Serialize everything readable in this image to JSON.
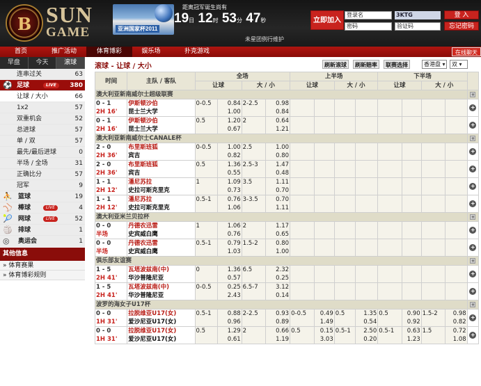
{
  "header": {
    "brand_top": "SUN",
    "brand_bottom": "GAME",
    "emblem": "B",
    "banner_text": "亚洲国家杯2011",
    "countdown_title": "距离冠军诞生尚有",
    "countdown": {
      "days": "19",
      "d_unit": "日",
      "hours": "12",
      "h_unit": "时",
      "minutes": "53",
      "m_unit": "分",
      "seconds": "47",
      "s_unit": "秒"
    },
    "maintenance": "未星团例行维护",
    "join_label": "立即加入",
    "username_value": "登录名",
    "password_value": "密码",
    "verify_value": "验证码",
    "verify_code": "3KTG",
    "login_label": "登 入",
    "forgot_label": "忘记密码"
  },
  "nav": {
    "items": [
      "首页",
      "推广活动",
      "体育博彩",
      "娱乐场",
      "扑克游戏"
    ],
    "online": "在线聊天"
  },
  "sidebar": {
    "tabs": [
      "早盘",
      "今天",
      "滚球"
    ],
    "rows": [
      {
        "label": "连串过关",
        "count": "63",
        "kind": "plain"
      },
      {
        "label": "足球",
        "count": "380",
        "kind": "active",
        "live": "LIVE",
        "icon": "soccer-icon"
      },
      {
        "label": "让球 / 大小",
        "count": "66",
        "kind": "sel"
      },
      {
        "label": "1x2",
        "count": "57",
        "kind": "plain"
      },
      {
        "label": "双重机会",
        "count": "52",
        "kind": "plain"
      },
      {
        "label": "总进球",
        "count": "57",
        "kind": "plain"
      },
      {
        "label": "单 / 双",
        "count": "57",
        "kind": "plain"
      },
      {
        "label": "最先/最后进球",
        "count": "0",
        "kind": "plain"
      },
      {
        "label": "半场 / 全场",
        "count": "31",
        "kind": "plain"
      },
      {
        "label": "正确比分",
        "count": "57",
        "kind": "plain"
      },
      {
        "label": "冠军",
        "count": "9",
        "kind": "plain"
      },
      {
        "label": "篮球",
        "count": "19",
        "kind": "sport",
        "icon": "basketball-icon"
      },
      {
        "label": "棒球",
        "count": "4",
        "kind": "sport",
        "live": "LIVE",
        "icon": "baseball-icon"
      },
      {
        "label": "网球",
        "count": "52",
        "kind": "sport",
        "live": "LIVE",
        "icon": "tennis-icon"
      },
      {
        "label": "排球",
        "count": "1",
        "kind": "sport",
        "icon": "volleyball-icon"
      },
      {
        "label": "奥运会",
        "count": "1",
        "kind": "sport",
        "icon": "olympic-rings-icon"
      }
    ],
    "info_title": "其他信息",
    "info_links": [
      "» 体育赛果",
      "» 体育博彩规则"
    ]
  },
  "main": {
    "title": "滚球 - 让球 / 大小",
    "refresh": "刷新滚球",
    "refresh_early": "刷新赔率",
    "league_select": "联赛选择",
    "odds_type": "香港盘",
    "sort": "双",
    "headers": {
      "time": "时间",
      "teams": "主队 / 客队",
      "full": "全场",
      "first": "上半场",
      "second": "下半场",
      "hdp": "让球",
      "ou": "大 / 小"
    },
    "leagues": [
      {
        "name": "澳大利亚新南威尔士超级联赛",
        "events": [
          {
            "score": "0 - 1",
            "time": "2H 16'",
            "home": "伊斯顿沙伯",
            "away": "昆士兰大学",
            "hdp": "0-0.5",
            "h1": "0.84",
            "h2": "1.00",
            "ou": "2-2.5",
            "o1": "0.98",
            "o2": "0.84",
            "fh": "",
            "f1": "",
            "f2": "",
            "fo": "",
            "fo1": "",
            "fo2": "",
            "sh": "",
            "s1": "",
            "s2": "",
            "so": "",
            "so1": "",
            "so2": ""
          },
          {
            "score": "0 - 1",
            "time": "2H 16'",
            "home": "伊斯顿沙伯",
            "away": "昆士兰大学",
            "hdp": "0.5",
            "h1": "1.20",
            "h2": "0.67",
            "ou": "2",
            "o1": "0.64",
            "o2": "1.21",
            "fh": "",
            "f1": "",
            "f2": "",
            "fo": "",
            "fo1": "",
            "fo2": "",
            "sh": "",
            "s1": "",
            "s2": "",
            "so": "",
            "so1": "",
            "so2": ""
          }
        ]
      },
      {
        "name": "澳大利亚新南威尔士CANALE杯",
        "events": [
          {
            "score": "2 - 0",
            "time": "2H 36'",
            "home": "布里斯班狐",
            "away": "宾吉",
            "hdp": "0-0.5",
            "h1": "1.00",
            "h2": "0.82",
            "ou": "2.5",
            "o1": "1.00",
            "o2": "0.80",
            "fh": "",
            "f1": "",
            "f2": "",
            "fo": "",
            "fo1": "",
            "fo2": "",
            "sh": "",
            "s1": "",
            "s2": "",
            "so": "",
            "so1": "",
            "so2": ""
          },
          {
            "score": "2 - 0",
            "time": "2H 36'",
            "home": "布里斯班狐",
            "away": "宾吉",
            "hdp": "0.5",
            "h1": "1.36",
            "h2": "0.55",
            "ou": "2.5-3",
            "o1": "1.47",
            "o2": "0.48",
            "fh": "",
            "f1": "",
            "f2": "",
            "fo": "",
            "fo1": "",
            "fo2": "",
            "sh": "",
            "s1": "",
            "s2": "",
            "so": "",
            "so1": "",
            "so2": ""
          },
          {
            "score": "1 - 1",
            "time": "2H 12'",
            "home": "潘尼苏拉",
            "away": "史拉可斯克里克",
            "hdp": "1",
            "h1": "1.09",
            "h2": "0.73",
            "ou": "3.5",
            "o1": "1.11",
            "o2": "0.70",
            "fh": "",
            "f1": "",
            "f2": "",
            "fo": "",
            "fo1": "",
            "fo2": "",
            "sh": "",
            "s1": "",
            "s2": "",
            "so": "",
            "so1": "",
            "so2": ""
          },
          {
            "score": "1 - 1",
            "time": "2H 12'",
            "home": "潘尼苏拉",
            "away": "史拉可斯克里克",
            "hdp": "0.5-1",
            "h1": "0.76",
            "h2": "1.06",
            "ou": "3-3.5",
            "o1": "0.70",
            "o2": "1.11",
            "fh": "",
            "f1": "",
            "f2": "",
            "fo": "",
            "fo1": "",
            "fo2": "",
            "sh": "",
            "s1": "",
            "s2": "",
            "so": "",
            "so1": "",
            "so2": ""
          }
        ]
      },
      {
        "name": "澳大利亚米兰贝拉杯",
        "events": [
          {
            "score": "0 - 0",
            "time": "半场",
            "home": "丹德农迅雷",
            "away": "史宾威白鹰",
            "hdp": "1",
            "h1": "1.06",
            "h2": "0.76",
            "ou": "2",
            "o1": "1.17",
            "o2": "0.65",
            "fh": "",
            "f1": "",
            "f2": "",
            "fo": "",
            "fo1": "",
            "fo2": "",
            "sh": "",
            "s1": "",
            "s2": "",
            "so": "",
            "so1": "",
            "so2": ""
          },
          {
            "score": "0 - 0",
            "time": "半场",
            "home": "丹德农迅雷",
            "away": "史宾威白鹰",
            "hdp": "0.5-1",
            "h1": "0.79",
            "h2": "1.03",
            "ou": "1.5-2",
            "o1": "0.80",
            "o2": "1.00",
            "fh": "",
            "f1": "",
            "f2": "",
            "fo": "",
            "fo1": "",
            "fo2": "",
            "sh": "",
            "s1": "",
            "s2": "",
            "so": "",
            "so1": "",
            "so2": ""
          }
        ]
      },
      {
        "name": "俱乐部友谊赛",
        "events": [
          {
            "score": "1 - 5",
            "time": "2H 41'",
            "home": "瓦塔波兹南(中)",
            "away": "华沙普隆尼亚",
            "hdp": "0",
            "h1": "1.36",
            "h2": "0.57",
            "ou": "6.5",
            "o1": "2.32",
            "o2": "0.25",
            "fh": "",
            "f1": "",
            "f2": "",
            "fo": "",
            "fo1": "",
            "fo2": "",
            "sh": "",
            "s1": "",
            "s2": "",
            "so": "",
            "so1": "",
            "so2": ""
          },
          {
            "score": "1 - 5",
            "time": "2H 41'",
            "home": "瓦塔波兹南(中)",
            "away": "华沙普隆尼亚",
            "hdp": "0-0.5",
            "h1": "0.25",
            "h2": "2.43",
            "ou": "6.5-7",
            "o1": "3.12",
            "o2": "0.14",
            "fh": "",
            "f1": "",
            "f2": "",
            "fo": "",
            "fo1": "",
            "fo2": "",
            "sh": "",
            "s1": "",
            "s2": "",
            "so": "",
            "so1": "",
            "so2": ""
          }
        ]
      },
      {
        "name": "波罗的海女子U17杯",
        "events": [
          {
            "score": "0 - 0",
            "time": "1H 31'",
            "home": "拉脱维亚U17(女)",
            "away": "爱沙尼亚U17(女)",
            "hdp": "0.5-1",
            "h1": "0.88",
            "h2": "0.96",
            "ou": "2-2.5",
            "o1": "0.93",
            "o2": "0.89",
            "fh": "0-0.5",
            "f1": "0.49",
            "f2": "1.49",
            "fo": "0.5",
            "fo1": "1.35",
            "fo2": "0.54",
            "sh": "0.5",
            "s1": "0.90",
            "s2": "0.92",
            "so": "1.5-2",
            "so1": "0.98",
            "so2": "0.82"
          },
          {
            "score": "0 - 0",
            "time": "1H 31'",
            "home": "拉脱维亚U17(女)",
            "away": "爱沙尼亚U17(女)",
            "hdp": "0.5",
            "h1": "1.29",
            "h2": "0.61",
            "ou": "2",
            "o1": "0.66",
            "o2": "1.19",
            "fh": "0.5",
            "f1": "0.15",
            "f2": "3.03",
            "fo": "0.5-1",
            "fo1": "2.50",
            "fo2": "0.20",
            "sh": "0.5-1",
            "s1": "0.63",
            "s2": "1.23",
            "so": "1.5",
            "so1": "0.72",
            "so2": "1.08"
          }
        ]
      }
    ]
  }
}
